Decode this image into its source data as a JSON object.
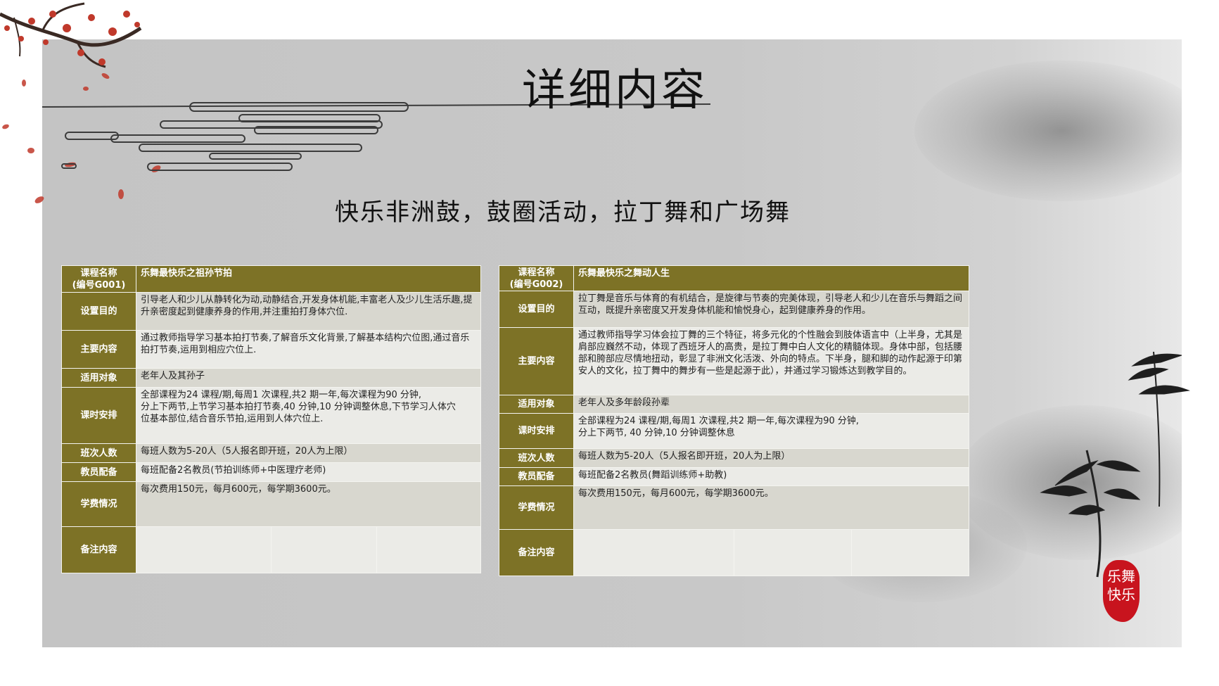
{
  "title": "详细内容",
  "subtitle": "快乐非洲鼓，鼓圈活动，拉丁舞和广场舞",
  "seal": {
    "line1": "乐舞",
    "line2": "快乐"
  },
  "colors": {
    "label_bg": "#7d7226",
    "row_light": "#ebebe7",
    "row_mid": "#d8d7cf",
    "slide_bg": "#c8c8c8",
    "seal": "#c8141e"
  },
  "icons": [
    "plum-blossom-branch",
    "cloud-lines",
    "bamboo",
    "ink-mountains"
  ],
  "course1": {
    "name_label": "课程名称",
    "code": "(编号G001)",
    "name": "乐舞最快乐之祖孙节拍",
    "purpose_label": "设置目的",
    "purpose": "引导老人和少儿从静转化为动,动静结合,开发身体机能,丰富老人及少儿生活乐趣,提升亲密度起到健康养身的作用,并注重拍打身体穴位.",
    "content_label": "主要内容",
    "content": "通过教师指导学习基本拍打节奏,了解音乐文化背景,了解基本结构穴位图,通过音乐拍打节奏,运用到相应穴位上.",
    "target_label": "适用对象",
    "target": "老年人及其孙子",
    "schedule_label": "课时安排",
    "schedule": [
      "全部课程为24 课程/期,每周1 次课程,共2 期一年,每次课程为90 分钟,",
      "分上下两节,上节学习基本拍打节奏,40 分钟,10 分钟调整休息,下节学习人体穴",
      "位基本部位,结合音乐节拍,运用到人体穴位上."
    ],
    "class_size_label": "班次人数",
    "class_size": "每班人数为5-20人（5人报名即开班，20人为上限）",
    "teachers_label": "教员配备",
    "teachers": "每班配备2名教员(节拍训练师+中医理疗老师)",
    "fees_label": "学费情况",
    "fees": "每次费用150元，每月600元，每学期3600元。",
    "notes_label": "备注内容"
  },
  "course2": {
    "name_label": "课程名称",
    "code": "(编号G002)",
    "name": "乐舞最快乐之舞动人生",
    "purpose_label": "设置目的",
    "purpose": "拉丁舞是音乐与体育的有机结合，是旋律与节奏的完美体现，引导老人和少儿在音乐与舞蹈之间互动，既提升亲密度又开发身体机能和愉悦身心，起到健康养身的作用。",
    "content_label": "主要内容",
    "content": "通过教师指导学习体会拉丁舞的三个特征，将多元化的个性融会到肢体语言中（上半身，尤其是肩部应巍然不动，体现了西班牙人的高贵，是拉丁舞中白人文化的精髓体现。身体中部，包括腰部和胯部应尽情地扭动，彰显了非洲文化活泼、外向的特点。下半身，腿和脚的动作起源于印第安人的文化，拉丁舞中的舞步有一些是起源于此），并通过学习锻炼达到教学目的。",
    "target_label": "适用对象",
    "target": "老年人及多年龄段孙辈",
    "schedule_label": "课时安排",
    "schedule": [
      "全部课程为24 课程/期,每周1 次课程,共2 期一年,每次课程为90 分钟,",
      "分上下两节, 40 分钟,10 分钟调整休息"
    ],
    "class_size_label": "班次人数",
    "class_size": "每班人数为5-20人（5人报名即开班，20人为上限）",
    "teachers_label": "教员配备",
    "teachers": "每班配备2名教员(舞蹈训练师+助教)",
    "fees_label": "学费情况",
    "fees": "每次费用150元，每月600元，每学期3600元。",
    "notes_label": "备注内容"
  }
}
